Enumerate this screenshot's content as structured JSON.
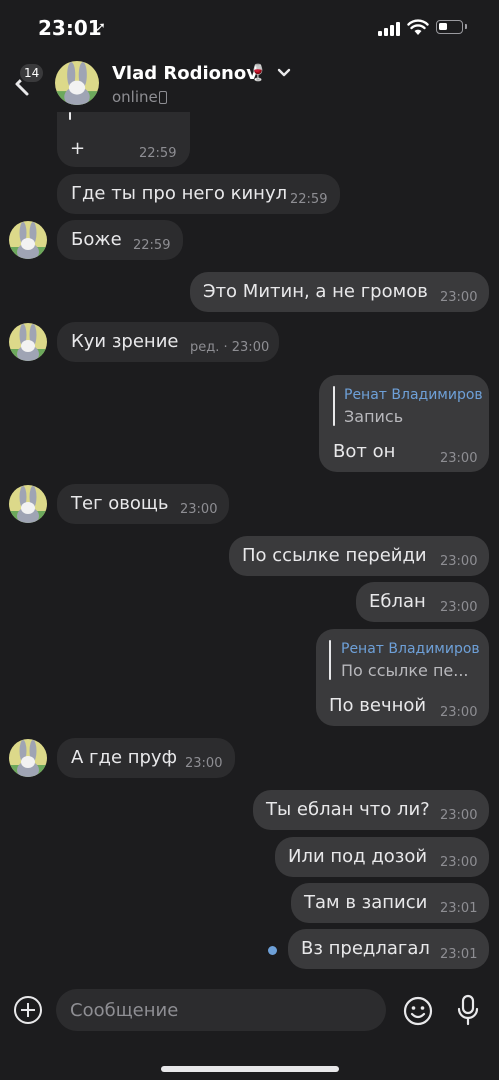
{
  "status_bar": {
    "time": "23:01"
  },
  "header": {
    "unread_count": "14",
    "contact_name": "Vlad Rodionov",
    "name_emoji": "🍷",
    "presence": "online"
  },
  "messages": [
    {
      "side": "in",
      "text": "+",
      "time": "22:59"
    },
    {
      "side": "in",
      "text": "Где ты про него кинул",
      "time": "22:59"
    },
    {
      "side": "in",
      "text": "Боже",
      "time": "22:59"
    },
    {
      "side": "out",
      "text": "Это Митин, а не громов",
      "time": "23:00"
    },
    {
      "side": "in",
      "text": "Куи зрение",
      "time": "ред. · 23:00"
    },
    {
      "side": "out",
      "reply_author": "Ренат Владимиров",
      "reply_text": "Запись",
      "text": "Вот он",
      "time": "23:00"
    },
    {
      "side": "in",
      "text": "Тег овощь",
      "time": "23:00"
    },
    {
      "side": "out",
      "text": "По ссылке перейди",
      "time": "23:00"
    },
    {
      "side": "out",
      "text": "Еблан",
      "time": "23:00"
    },
    {
      "side": "out",
      "reply_author": "Ренат Владимиров",
      "reply_text": "По ссылке пе...",
      "text": "По вечной",
      "time": "23:00"
    },
    {
      "side": "in",
      "text": "А где пруф",
      "time": "23:00"
    },
    {
      "side": "out",
      "text": "Ты еблан что ли?",
      "time": "23:00"
    },
    {
      "side": "out",
      "text": "Или под дозой",
      "time": "23:00"
    },
    {
      "side": "out",
      "text": "Там в записи",
      "time": "23:01"
    },
    {
      "side": "out",
      "text": "Вз предлагал",
      "time": "23:01",
      "unread": true
    }
  ],
  "composer": {
    "placeholder": "Сообщение"
  },
  "colors": {
    "background": "#1c1c1e",
    "incoming_bubble": "#2c2c2e",
    "outgoing_bubble": "#3a3a3c",
    "accent": "#6ea0d8"
  }
}
